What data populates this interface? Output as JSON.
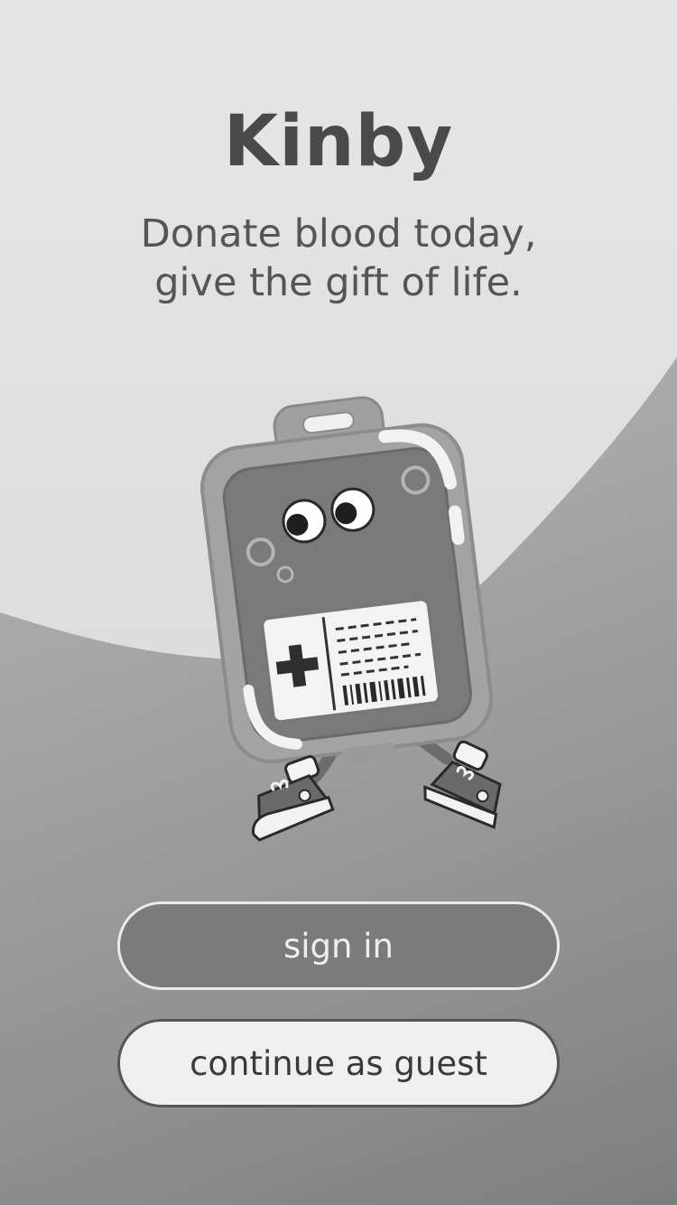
{
  "app": {
    "title": "Kinby",
    "tagline_line1": "Donate blood today,",
    "tagline_line2": "give the gift of life."
  },
  "illustration": {
    "icon": "blood-bag-mascot-icon"
  },
  "actions": {
    "sign_in_label": "sign in",
    "guest_label": "continue as guest"
  },
  "colors": {
    "title_text": "#4a4a4a",
    "sign_in_background": "#7b7b7b",
    "guest_background": "#efefef"
  }
}
